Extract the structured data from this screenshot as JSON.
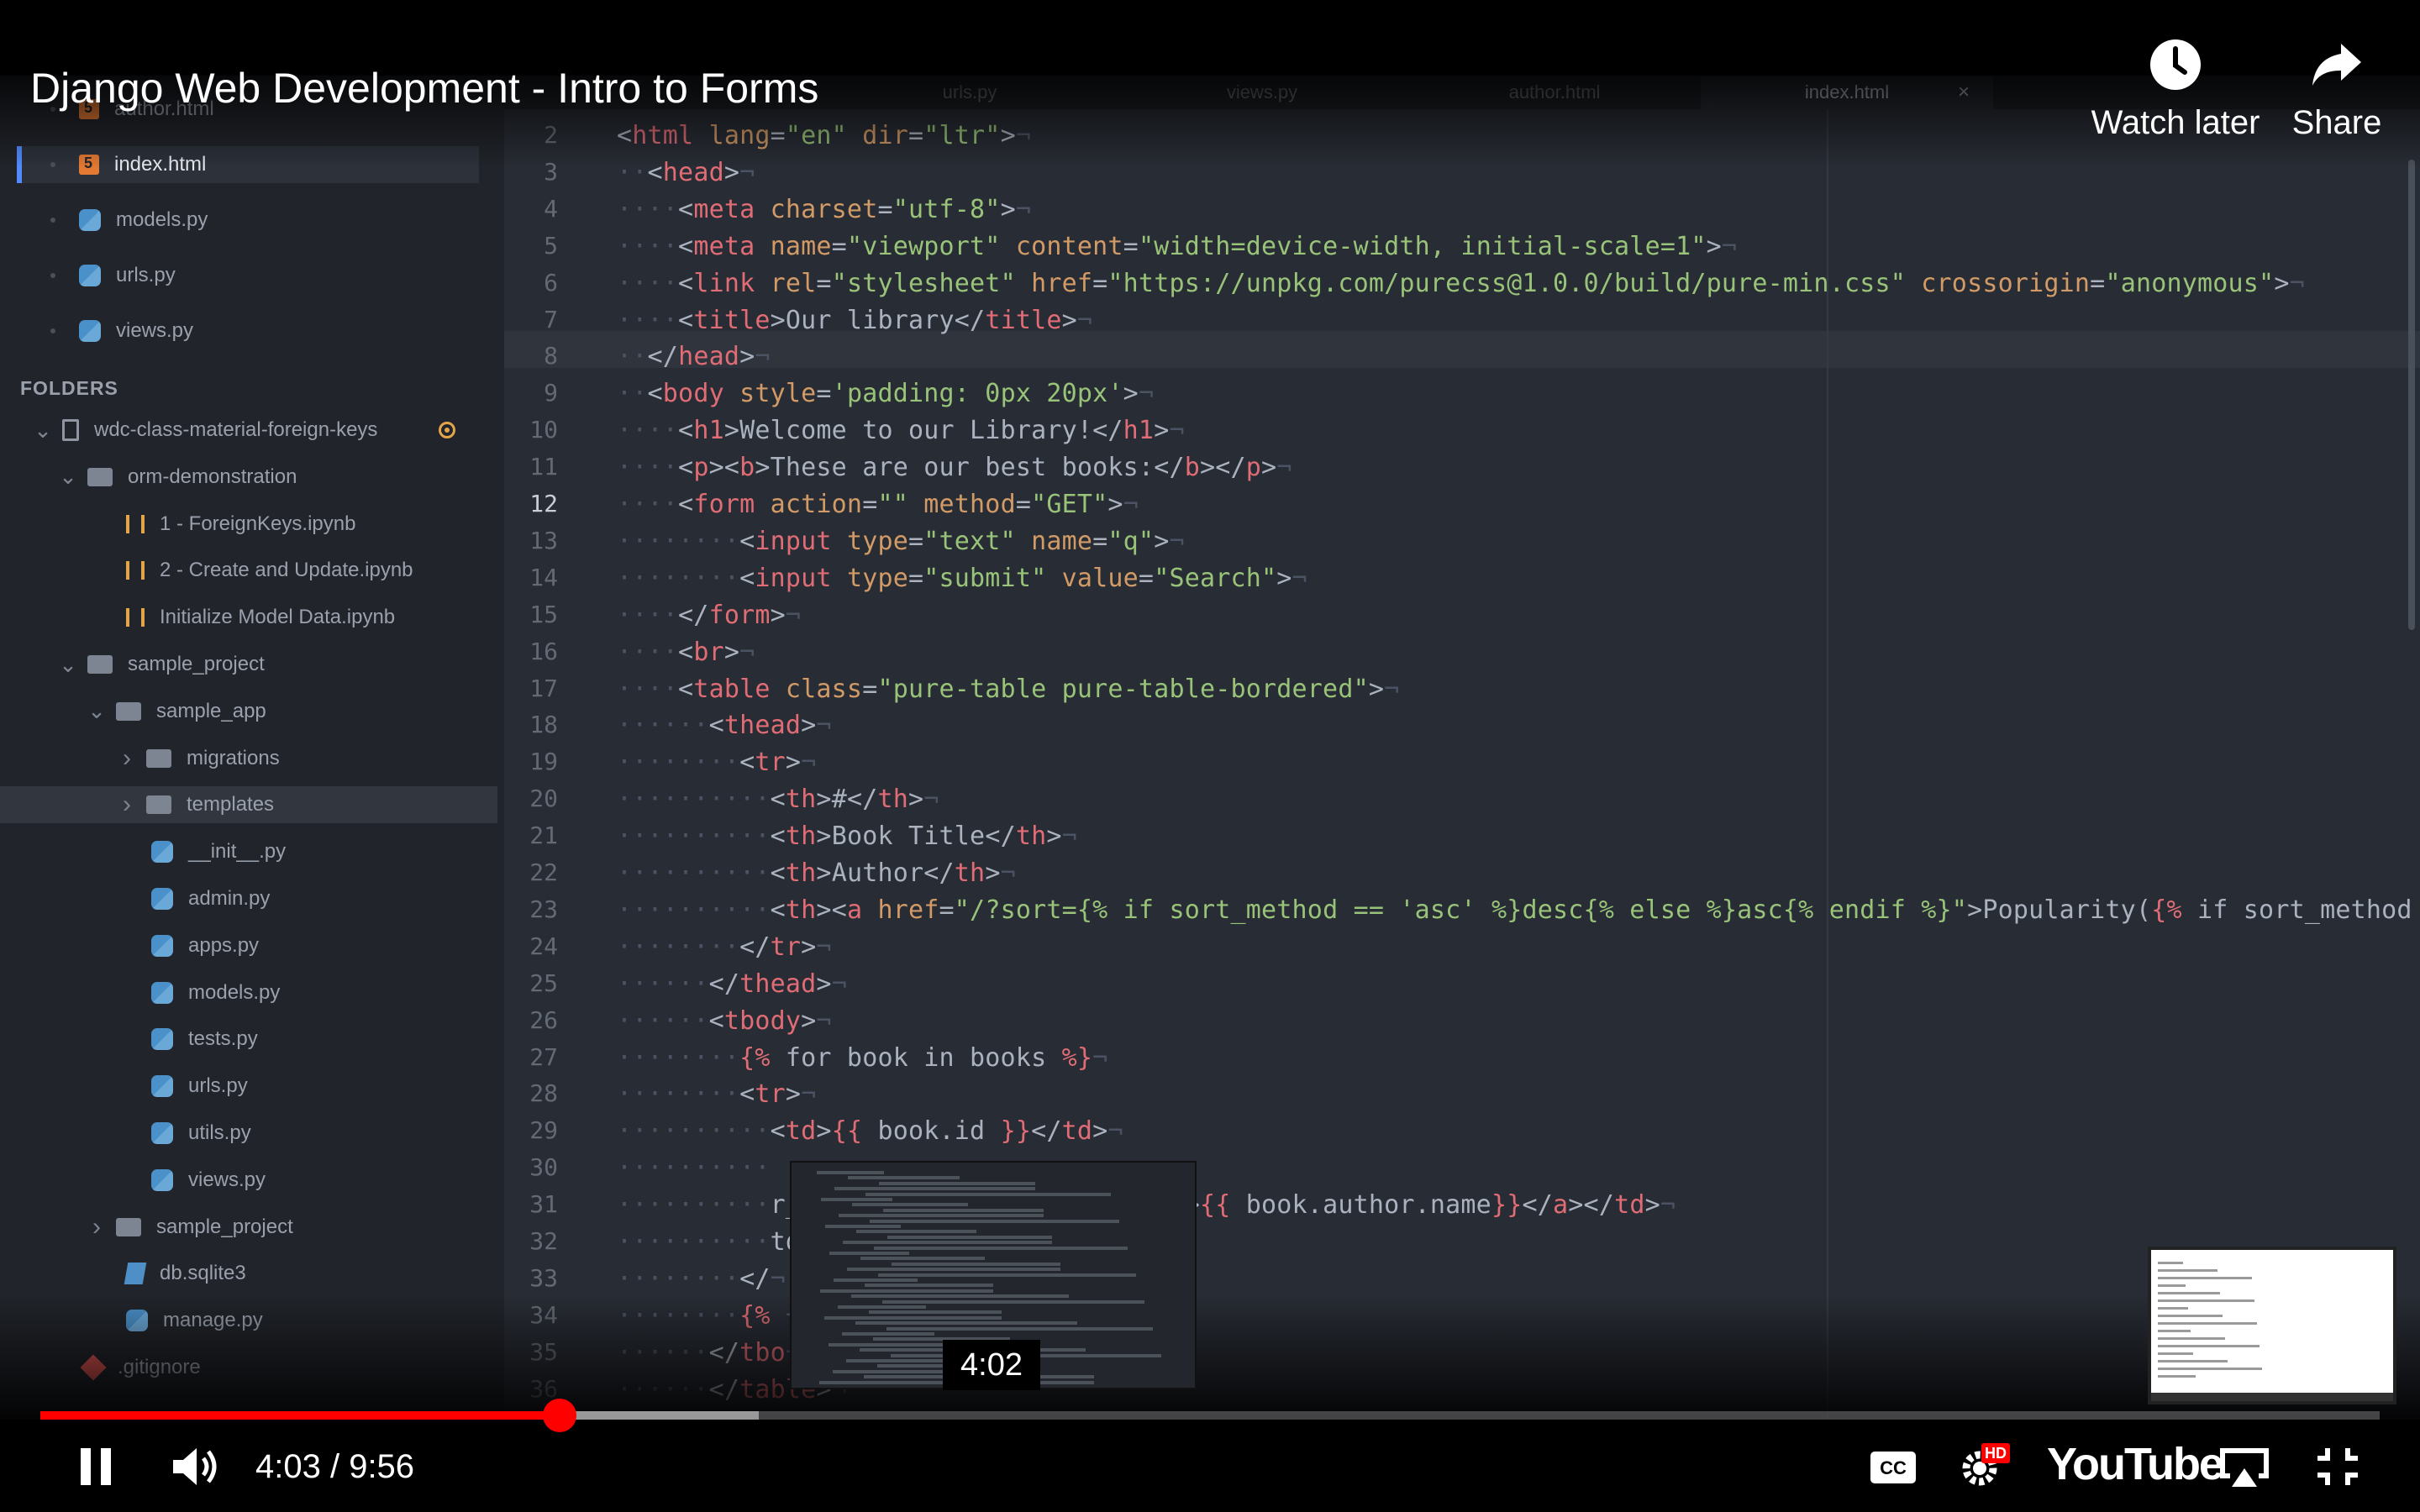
{
  "video": {
    "title": "Django Web Development - Intro to Forms",
    "watch_later_label": "Watch later",
    "share_label": "Share",
    "current_time": "4:03",
    "duration": "9:56",
    "time_display": "4:03 / 9:56",
    "preview_time": "4:02",
    "progress_played_fraction": 0.222,
    "progress_buffered_fraction": 0.307,
    "logo_text": "YouTube",
    "hd_badge": "HD",
    "cc_label": "CC"
  },
  "editor": {
    "tabs": [
      {
        "label": "urls.py"
      },
      {
        "label": "views.py"
      },
      {
        "label": "author.html"
      },
      {
        "label": "index.html",
        "active": true
      }
    ],
    "tab_close_glyph": "×",
    "sidebar": {
      "open_files": [
        {
          "label": "author.html",
          "icon": "html-file-icon"
        },
        {
          "label": "index.html",
          "icon": "html-file-icon",
          "active": true
        },
        {
          "label": "models.py",
          "icon": "python-file-icon"
        },
        {
          "label": "urls.py",
          "icon": "python-file-icon"
        },
        {
          "label": "views.py",
          "icon": "python-file-icon"
        }
      ],
      "folders_header": "FOLDERS",
      "tree": [
        {
          "label": "wdc-class-material-foreign-keys",
          "icon": "repo-icon"
        },
        {
          "label": "orm-demonstration",
          "icon": "folder-icon"
        },
        {
          "label": "1 - ForeignKeys.ipynb",
          "icon": "notebook-icon"
        },
        {
          "label": "2 - Create and Update.ipynb",
          "icon": "notebook-icon"
        },
        {
          "label": "Initialize Model Data.ipynb",
          "icon": "notebook-icon"
        },
        {
          "label": "sample_project",
          "icon": "folder-icon"
        },
        {
          "label": "sample_app",
          "icon": "folder-icon"
        },
        {
          "label": "migrations",
          "icon": "folder-icon"
        },
        {
          "label": "templates",
          "icon": "folder-icon",
          "selected": true
        },
        {
          "label": "__init__.py",
          "icon": "python-file-icon"
        },
        {
          "label": "admin.py",
          "icon": "python-file-icon"
        },
        {
          "label": "apps.py",
          "icon": "python-file-icon"
        },
        {
          "label": "models.py",
          "icon": "python-file-icon"
        },
        {
          "label": "tests.py",
          "icon": "python-file-icon"
        },
        {
          "label": "urls.py",
          "icon": "python-file-icon"
        },
        {
          "label": "utils.py",
          "icon": "python-file-icon"
        },
        {
          "label": "views.py",
          "icon": "python-file-icon"
        },
        {
          "label": "sample_project",
          "icon": "folder-icon"
        },
        {
          "label": "db.sqlite3",
          "icon": "database-icon"
        },
        {
          "label": "manage.py",
          "icon": "python-file-icon"
        },
        {
          "label": ".gitignore",
          "icon": "git-icon"
        }
      ]
    },
    "line_numbers": [
      "2",
      "3",
      "4",
      "5",
      "6",
      "7",
      "8",
      "9",
      "10",
      "11",
      "12",
      "13",
      "14",
      "15",
      "16",
      "17",
      "18",
      "19",
      "20",
      "21",
      "22",
      "23",
      "24",
      "25",
      "26",
      "27",
      "28",
      "29",
      "30",
      "31",
      "32",
      "33",
      "34",
      "35",
      "36"
    ],
    "code_lines": [
      "<html lang=\"en\" dir=\"ltr\">",
      "<head>",
      "<meta charset=\"utf-8\">",
      "<meta name=\"viewport\" content=\"width=device-width, initial-scale=1\">",
      "<link rel=\"stylesheet\" href=\"https://unpkg.com/purecss@1.0.0/build/pure-min.css\" crossorigin=\"anonymous\">",
      "<title>Our library</title>",
      "</head>",
      "<body style='padding: 0px 20px'>",
      "<h1>Welcome to our Library!</h1>",
      "<p><b>These are our best books:</b></p>",
      "<form action=\"\" method=\"GET\">",
      "<input type=\"text\" name=\"q\">",
      "<input type=\"submit\" value=\"Search\">",
      "</form>",
      "<br>",
      "<table class=\"pure-table pure-table-bordered\">",
      "<thead>",
      "<tr>",
      "<th>#</th>",
      "<th>Book Title</th>",
      "<th>Author</th>",
      "<th><a href=\"/?sort={% if sort_method == 'asc' %}desc{% else %}asc{% endif %}\">Popularity({% if sort_method =",
      "</tr>",
      "</thead>",
      "<tbody>",
      "{% for book in books %}",
      "<tr>",
      "<td>{{ book.id }}</td>",
      "",
      "r_by_id' book.author.id %}\">{{ book.author.name}}</a></td>",
      "td>",
      "</",
      "{% ",
      "</tbo",
      "</table>"
    ]
  }
}
